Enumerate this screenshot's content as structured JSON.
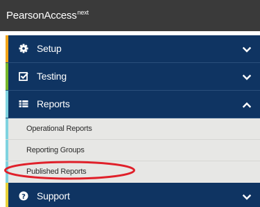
{
  "header": {
    "brand": "PearsonAccess",
    "brand_sup": "next"
  },
  "nav": {
    "items": [
      {
        "label": "Setup",
        "icon": "gear-icon",
        "stripe_color": "#f2a417",
        "state": "collapsed"
      },
      {
        "label": "Testing",
        "icon": "checkbox-icon",
        "stripe_color": "#76b82a",
        "state": "collapsed"
      },
      {
        "label": "Reports",
        "icon": "report-icon",
        "stripe_color": "#7fd3e0",
        "state": "expanded"
      },
      {
        "label": "Support",
        "icon": "help-icon",
        "stripe_color": "#e8d23a",
        "state": "collapsed"
      }
    ],
    "reports_subitems": [
      {
        "label": "Operational Reports"
      },
      {
        "label": "Reporting Groups"
      },
      {
        "label": "Published Reports",
        "highlighted": true
      }
    ]
  },
  "colors": {
    "header_bg": "#3a3a3a",
    "nav_bg": "#0f3462",
    "submenu_bg": "#e7e7e5",
    "callout": "#e0202a"
  }
}
